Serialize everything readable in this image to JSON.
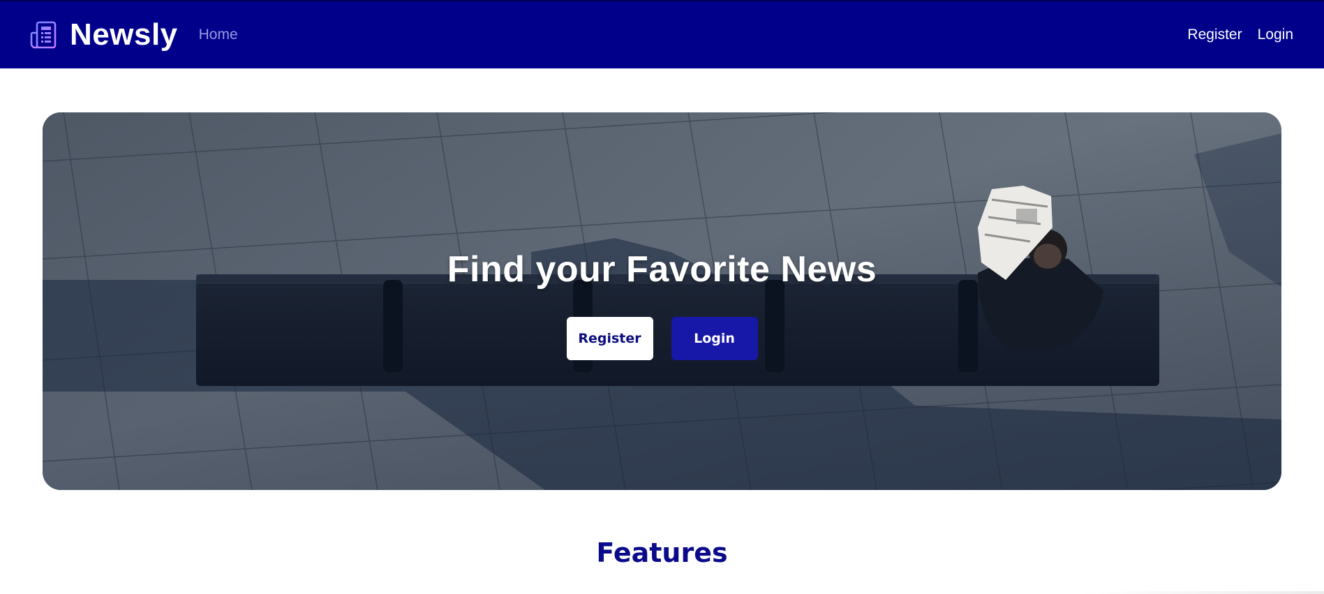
{
  "navbar": {
    "brand_name": "Newsly",
    "brand_icon": "newspaper-icon",
    "home_link": "Home",
    "register_link": "Register",
    "login_link": "Login",
    "background_color": "#00008b"
  },
  "hero": {
    "title": "Find your Favorite News",
    "register_button": "Register",
    "login_button": "Login",
    "image": "man-reading-newspaper-on-bench-photo"
  },
  "features": {
    "title": "Features"
  },
  "colors": {
    "primary": "#00008b",
    "button_primary": "#1717a8",
    "heading": "#0a0a8a",
    "nav_home": "#9a9ae0"
  }
}
